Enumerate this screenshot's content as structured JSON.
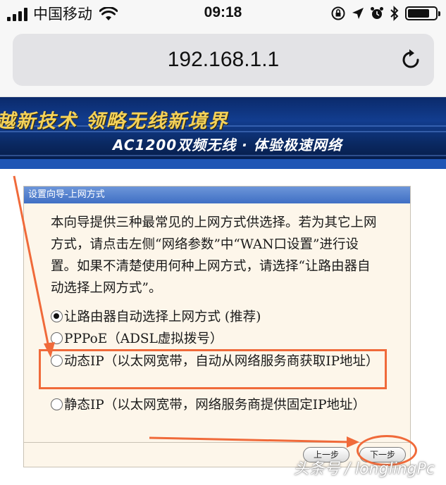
{
  "status_bar": {
    "carrier": "中国移动",
    "time": "09:18"
  },
  "browser": {
    "url": "192.168.1.1"
  },
  "banner": {
    "slogan_main": "越新技术 领略无线新境界",
    "slogan_sub": "AC1200双频无线 · 体验极速网络"
  },
  "wizard": {
    "title": "设置向导-上网方式",
    "intro": "本向导提供三种最常见的上网方式供选择。若为其它上网方式，请点击左侧“网络参数”中“WAN口设置”进行设置。如果不清楚使用何种上网方式，请选择“让路由器自动选择上网方式”。",
    "options": [
      {
        "label": "让路由器自动选择上网方式 (推荐)",
        "selected": true
      },
      {
        "label": "PPPoE（ADSL虚拟拨号）",
        "selected": false
      },
      {
        "label": "动态IP（以太网宽带，自动从网络服务商获取IP地址）",
        "selected": false
      },
      {
        "label": "静态IP（以太网宽带，网络服务商提供固定IP地址）",
        "selected": false
      }
    ],
    "prev_button": "上一步",
    "next_button": "下一步"
  },
  "watermark": "头条号 / longlingPc",
  "colors": {
    "annotation": "#f06a3a",
    "title_bar": "#4a78c8",
    "panel_bg": "#fdf6ea"
  }
}
